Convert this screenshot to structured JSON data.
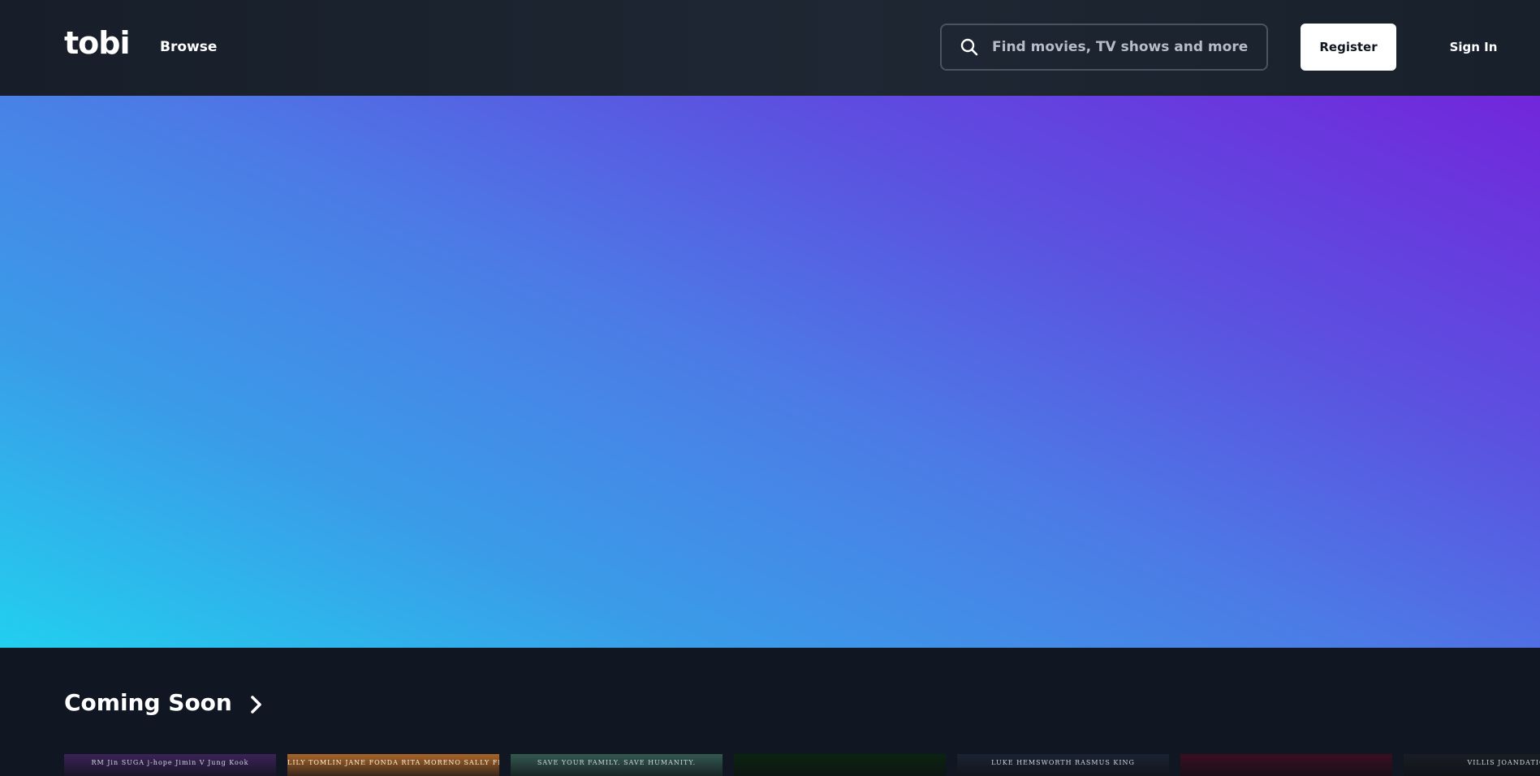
{
  "header": {
    "logo_text": "tobi",
    "nav": {
      "browse_label": "Browse"
    },
    "search": {
      "placeholder": "Find movies, TV shows and more",
      "value": "",
      "icon": "search-icon"
    },
    "register_label": "Register",
    "signin_label": "Sign In"
  },
  "hero": {
    "gradient_colors": [
      "#7226db",
      "#5c50e0",
      "#4b7de6",
      "#3a9ce8",
      "#22cfef"
    ]
  },
  "coming_soon": {
    "title": "Coming Soon",
    "more_icon": "chevron-right-icon",
    "posters": [
      {
        "caption": "RM  Jin  SUGA  j-hope  Jimin  V  Jung Kook",
        "color": "#3a2356"
      },
      {
        "caption": "LILY TOMLIN  JANE FONDA  RITA MORENO  SALLY FIELD  TOM BRADY",
        "color": "#a8642a"
      },
      {
        "caption": "SAVE YOUR FAMILY. SAVE HUMANITY.",
        "color": "#34584f"
      },
      {
        "caption": "",
        "color": "#0a2410"
      },
      {
        "caption": "LUKE HEMSWORTH   RASMUS KING",
        "color": "#1b2433"
      },
      {
        "caption": "",
        "color": "#3a0f22"
      },
      {
        "caption": "VILLIS JOANDATION",
        "color": "#1a1d25"
      }
    ]
  }
}
